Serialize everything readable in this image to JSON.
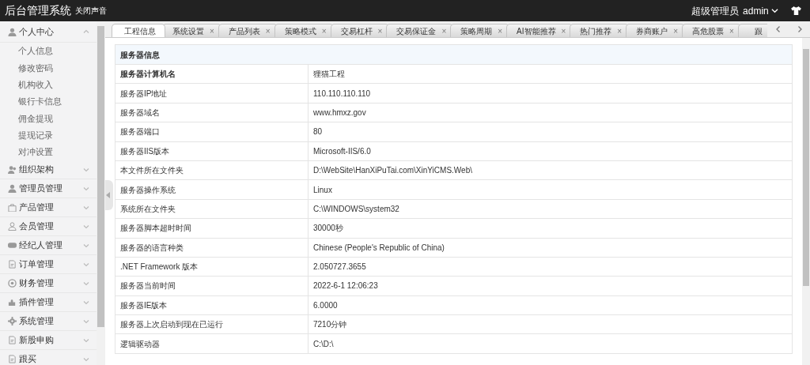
{
  "header": {
    "title": "后台管理系统",
    "sound_toggle": "关闭声音",
    "user_role": "超级管理员",
    "username": "admin"
  },
  "sidebar": {
    "groups": [
      {
        "label": "个人中心",
        "expanded": true,
        "children": [
          {
            "label": "个人信息"
          },
          {
            "label": "修改密码"
          },
          {
            "label": "机构收入"
          },
          {
            "label": "银行卡信息"
          },
          {
            "label": "佣金提现"
          },
          {
            "label": "提现记录"
          },
          {
            "label": "对冲设置"
          }
        ]
      },
      {
        "label": "组织架构",
        "expanded": false
      },
      {
        "label": "管理员管理",
        "expanded": false
      },
      {
        "label": "产品管理",
        "expanded": false
      },
      {
        "label": "会员管理",
        "expanded": false
      },
      {
        "label": "经纪人管理",
        "expanded": false
      },
      {
        "label": "订单管理",
        "expanded": false
      },
      {
        "label": "财务管理",
        "expanded": false
      },
      {
        "label": "插件管理",
        "expanded": false
      },
      {
        "label": "系统管理",
        "expanded": false
      },
      {
        "label": "新股申购",
        "expanded": false
      },
      {
        "label": "跟买",
        "expanded": false
      }
    ]
  },
  "tabs": [
    {
      "label": "工程信息",
      "selected": true
    },
    {
      "label": "系统设置",
      "selected": false,
      "close": "×"
    },
    {
      "label": "产品列表",
      "selected": false,
      "close": "×"
    },
    {
      "label": "策略模式",
      "selected": false,
      "close": "×"
    },
    {
      "label": "交易杠杆",
      "selected": false,
      "close": "×"
    },
    {
      "label": "交易保证金",
      "selected": false,
      "close": "×"
    },
    {
      "label": "策略周期",
      "selected": false,
      "close": "×"
    },
    {
      "label": "AI智能推荐",
      "selected": false,
      "close": "×"
    },
    {
      "label": "热门推荐",
      "selected": false,
      "close": "×"
    },
    {
      "label": "券商账户",
      "selected": false,
      "close": "×"
    },
    {
      "label": "高危股票",
      "selected": false,
      "close": "×"
    },
    {
      "label": "跟",
      "selected": false
    }
  ],
  "table": {
    "title": "服务器信息",
    "rows": [
      {
        "name": "服务器计算机名",
        "value": "狸猫工程",
        "bold": true
      },
      {
        "name": "服务器IP地址",
        "value": "110.110.110.110",
        "bold": false
      },
      {
        "name": "服务器域名",
        "value": "www.hmxz.gov",
        "bold": false
      },
      {
        "name": "服务器端口",
        "value": "80",
        "bold": false
      },
      {
        "name": "服务器IIS版本",
        "value": "Microsoft-IIS/6.0",
        "bold": false
      },
      {
        "name": "本文件所在文件夹",
        "value": "D:\\WebSite\\HanXiPuTai.com\\XinYiCMS.Web\\",
        "bold": false
      },
      {
        "name": "服务器操作系统",
        "value": "Linux",
        "bold": false
      },
      {
        "name": "系统所在文件夹",
        "value": "C:\\WINDOWS\\system32",
        "bold": false
      },
      {
        "name": "服务器脚本超时时间",
        "value": "30000秒",
        "bold": false
      },
      {
        "name": "服务器的语言种类",
        "value": "Chinese (People's Republic of China)",
        "bold": false
      },
      {
        "name": ".NET Framework 版本",
        "value": "2.050727.3655",
        "bold": false
      },
      {
        "name": "服务器当前时间",
        "value": "2022-6-1 12:06:23",
        "bold": false
      },
      {
        "name": "服务器IE版本",
        "value": "6.0000",
        "bold": false
      },
      {
        "name": "服务器上次启动到现在已运行",
        "value": "7210分钟",
        "bold": false
      },
      {
        "name": "逻辑驱动器",
        "value": "C:\\D:\\",
        "bold": false
      }
    ]
  }
}
